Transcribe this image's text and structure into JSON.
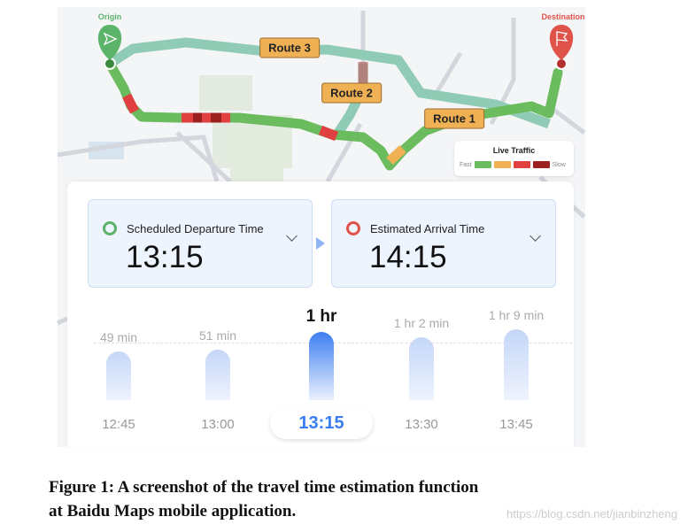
{
  "map": {
    "origin_label": "Origin",
    "destination_label": "Destination",
    "routes": [
      "Route 3",
      "Route 2",
      "Route 1"
    ],
    "legend": {
      "title": "Live Traffic",
      "fast": "Fast",
      "slow": "Slow",
      "colors": [
        "#6bbb5f",
        "#f0b155",
        "#e04040",
        "#9b2020"
      ]
    }
  },
  "departure": {
    "label": "Scheduled Departure Time",
    "time": "13:15",
    "color": "#5cb36a"
  },
  "arrival": {
    "label": "Estimated Arrival Time",
    "time": "14:15",
    "color": "#e0534a"
  },
  "chart_data": {
    "type": "bar",
    "categories": [
      "12:45",
      "13:00",
      "13:15",
      "13:30",
      "13:45"
    ],
    "values": [
      49,
      51,
      60,
      62,
      69
    ],
    "value_labels": [
      "49 min",
      "51 min",
      "1 hr",
      "1 hr 2 min",
      "1 hr 9 min"
    ],
    "selected": "13:15"
  },
  "caption": {
    "line1": "Figure 1: A screenshot of the travel time estimation function",
    "line2": "at Baidu Maps mobile application."
  },
  "watermark": "https://blog.csdn.net/jianbinzheng"
}
